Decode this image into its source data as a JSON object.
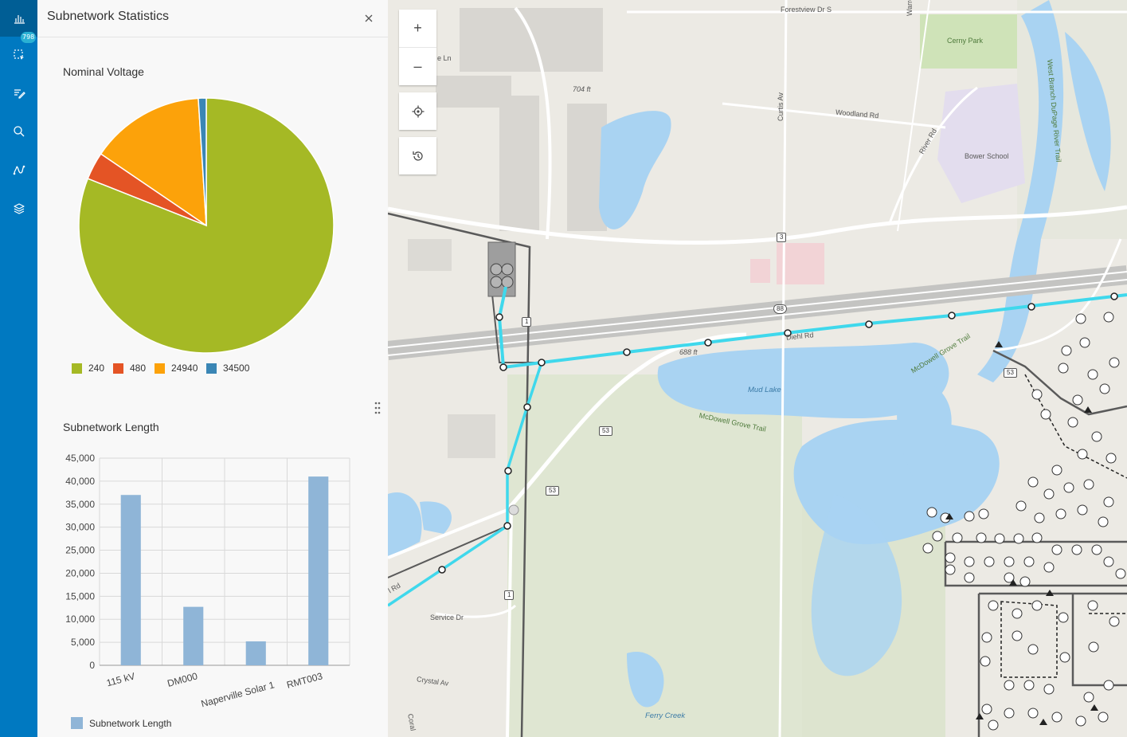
{
  "toolbar": {
    "items": [
      {
        "icon": "chart-icon",
        "active": true
      },
      {
        "icon": "select-icon",
        "badge": "798"
      },
      {
        "icon": "edit-icon"
      },
      {
        "icon": "search-icon"
      },
      {
        "icon": "trace-icon"
      },
      {
        "icon": "layers-icon"
      }
    ],
    "colors": {
      "background": "#0079c1",
      "active": "#005e95"
    }
  },
  "panel": {
    "title": "Subnetwork Statistics",
    "close_icon": "close-icon"
  },
  "pie_chart": {
    "title": "Nominal Voltage",
    "legend": [
      "240",
      "480",
      "24940",
      "34500"
    ],
    "colors": [
      "#a5b925",
      "#e45425",
      "#fca20a",
      "#3a86b5"
    ]
  },
  "bar_chart": {
    "title": "Subnetwork Length",
    "legend_label": "Subnetwork Length",
    "bar_color": "#8fb5d7",
    "y_ticks": [
      "0",
      "5,000",
      "10,000",
      "15,000",
      "20,000",
      "25,000",
      "30,000",
      "35,000",
      "40,000",
      "45,000"
    ],
    "x_labels": [
      "115 kV",
      "DM000",
      "Naperville Solar 1",
      "RMT003"
    ]
  },
  "chart_data": [
    {
      "type": "pie",
      "title": "Nominal Voltage",
      "categories": [
        "240",
        "480",
        "24940",
        "34500"
      ],
      "values": [
        81,
        3.5,
        14.5,
        1
      ],
      "colors": [
        "#a5b925",
        "#e45425",
        "#fca20a",
        "#3a86b5"
      ]
    },
    {
      "type": "bar",
      "title": "Subnetwork Length",
      "categories": [
        "115 kV",
        "DM000",
        "Naperville Solar 1",
        "RMT003"
      ],
      "series": [
        {
          "name": "Subnetwork Length",
          "values": [
            37000,
            12700,
            5200,
            41000
          ]
        }
      ],
      "ylim": [
        0,
        45000
      ],
      "grid": true,
      "legend": "bottom-left"
    }
  ],
  "map": {
    "buttons": [
      {
        "label": "+",
        "name": "zoom-in-button"
      },
      {
        "label": "–",
        "name": "zoom-out-button"
      }
    ],
    "labels": {
      "forestview": "Forestview Dr S",
      "warren": "Warren Av",
      "cerny": "Cerny Park",
      "woodland": "Woodland Rd",
      "curtis": "Curtis Av",
      "river": "River Rd",
      "bower": "Bower School",
      "westbranch": "West Branch DuPage River Trail",
      "elev704": "704 ft",
      "elev688": "688 ft",
      "diehl": "Diehl Rd",
      "mcdowell_grove": "McDowell Grove Trail",
      "mcdowell": "McDowell Grove Trail",
      "mud": "Mud Lake",
      "service": "Service Dr",
      "crystal": "Crystal Av",
      "ferry": "Ferry Creek",
      "coral": "Coral",
      "te_ln": "e Ln",
      "rd_left": "l Rd",
      "route3": "3",
      "i88": "88",
      "route53a": "53",
      "route53b": "53",
      "route1a": "1",
      "route1b": "1",
      "route53c": "53"
    }
  }
}
